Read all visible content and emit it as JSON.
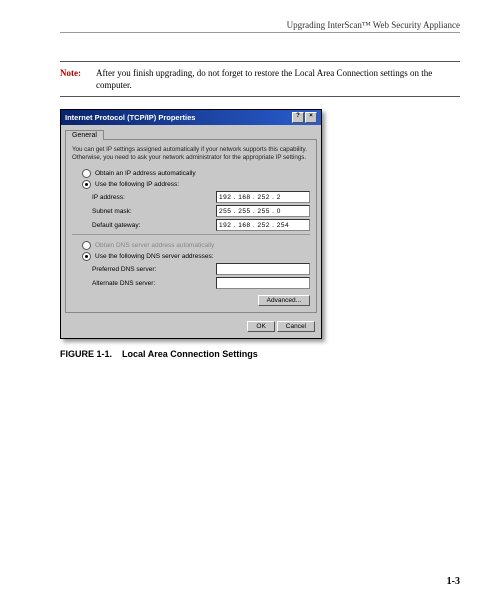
{
  "header": {
    "title": "Upgrading InterScan™ Web Security Appliance"
  },
  "note": {
    "label": "Note:",
    "text": "After you finish upgrading, do not forget to restore the Local Area Connection settings on the computer."
  },
  "dialog": {
    "title": "Internet Protocol (TCP/IP) Properties",
    "help_glyph": "?",
    "close_glyph": "×",
    "tab": "General",
    "description": "You can get IP settings assigned automatically if your network supports this capability. Otherwise, you need to ask your network administrator for the appropriate IP settings.",
    "radio_auto_ip": "Obtain an IP address automatically",
    "radio_use_ip": "Use the following IP address:",
    "fields": {
      "ip_label": "IP address:",
      "ip_value": "192 . 168 . 252 .   2",
      "mask_label": "Subnet mask:",
      "mask_value": "255 . 255 . 255 .   0",
      "gw_label": "Default gateway:",
      "gw_value": "192 . 168 . 252 . 254"
    },
    "radio_auto_dns": "Obtain DNS server address automatically",
    "radio_use_dns": "Use the following DNS server addresses:",
    "dns": {
      "pref_label": "Preferred DNS server:",
      "pref_value": "",
      "alt_label": "Alternate DNS server:",
      "alt_value": ""
    },
    "advanced_btn": "Advanced...",
    "ok_btn": "OK",
    "cancel_btn": "Cancel"
  },
  "figure": {
    "label": "FIGURE 1-1.",
    "caption": "Local Area Connection Settings"
  },
  "page_number": "1-3"
}
